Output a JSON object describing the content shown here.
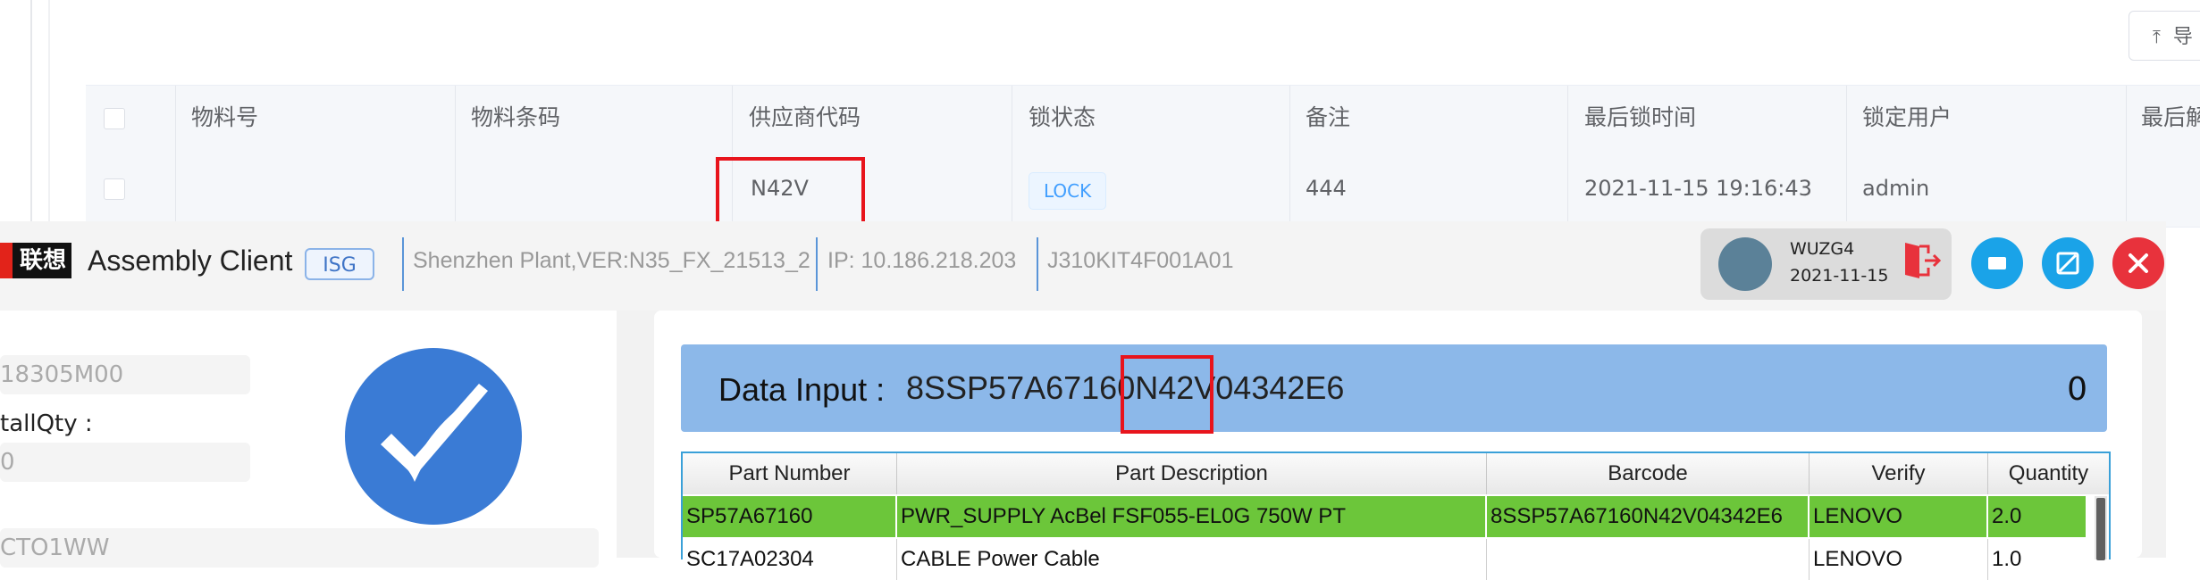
{
  "background_page": {
    "export_label": "导",
    "table": {
      "columns": [
        "物料号",
        "物料条码",
        "供应商代码",
        "锁状态",
        "备注",
        "最后锁时间",
        "锁定用户",
        "最后解"
      ],
      "row": {
        "vendor_code": "N42V",
        "lock_status": "LOCK",
        "remark": "444",
        "last_lock_time": "2021-11-15 19:16:43",
        "locked_user": "admin"
      }
    }
  },
  "client": {
    "logo_text": "联想",
    "title": "Assembly Client",
    "badge": "ISG",
    "plant": "Shenzhen Plant,VER:N35_FX_21513_2",
    "ip": "IP: 10.186.218.203",
    "station": "J310KIT4F001A01",
    "user": {
      "name": "WUZG4",
      "date": "2021-11-15"
    },
    "colors": {
      "minimize": "#1aa3e8",
      "restore": "#1aa3e8",
      "close": "#e8323c",
      "logout": "#e8323c"
    }
  },
  "left_panel": {
    "field1_value": "18305M00",
    "label": "tallQty :",
    "field2_value": "0",
    "field3_value": "CTO1WW"
  },
  "data_input": {
    "label": "Data Input :",
    "value": "8SSP57A67160N42V04342E6",
    "count": "0"
  },
  "grid": {
    "columns": [
      "Part Number",
      "Part Description",
      "Barcode",
      "Verify",
      "Quantity"
    ],
    "rows": [
      [
        "SP57A67160",
        "PWR_SUPPLY AcBel FSF055-EL0G 750W PT",
        "8SSP57A67160N42V04342E6",
        "LENOVO",
        "2.0"
      ],
      [
        "SC17A02304",
        "CABLE Power Cable",
        "",
        "LENOVO",
        "1.0"
      ]
    ]
  }
}
